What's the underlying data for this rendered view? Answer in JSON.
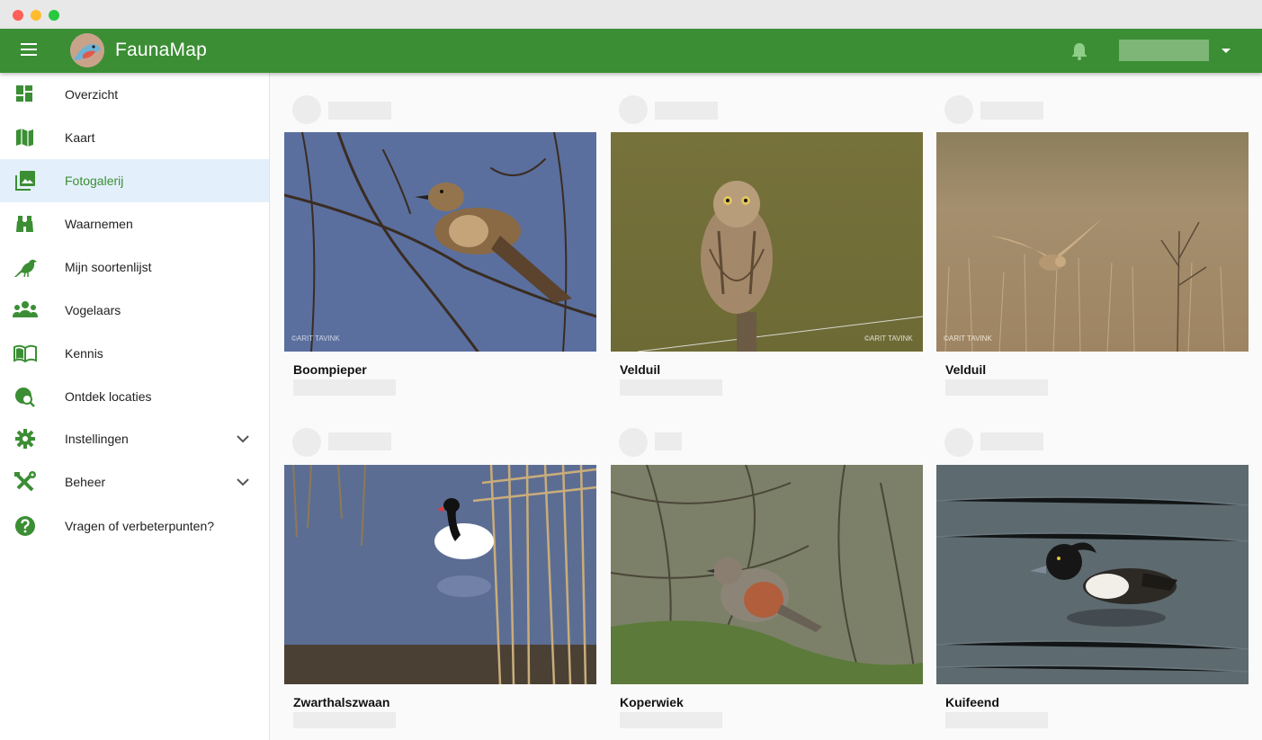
{
  "app": {
    "title": "FaunaMap",
    "brand_color": "#3b8e34",
    "active_color": "#e3f0fb"
  },
  "header": {
    "menu_icon": "hamburger-menu-icon",
    "notification_icon": "bell-icon",
    "user_menu_icon": "caret-down-icon"
  },
  "sidebar": {
    "items": [
      {
        "label": "Overzicht",
        "icon": "dashboard-icon"
      },
      {
        "label": "Kaart",
        "icon": "map-icon"
      },
      {
        "label": "Fotogalerij",
        "icon": "photo-library-icon",
        "active": true
      },
      {
        "label": "Waarnemen",
        "icon": "binoculars-icon"
      },
      {
        "label": "Mijn soortenlijst",
        "icon": "bird-icon"
      },
      {
        "label": "Vogelaars",
        "icon": "people-icon"
      },
      {
        "label": "Kennis",
        "icon": "book-icon"
      },
      {
        "label": "Ontdek locaties",
        "icon": "explore-location-icon"
      },
      {
        "label": "Instellingen",
        "icon": "gear-icon",
        "expandable": true
      },
      {
        "label": "Beheer",
        "icon": "tools-icon",
        "expandable": true
      },
      {
        "label": "Vragen of verbeterpunten?",
        "icon": "help-icon"
      }
    ]
  },
  "gallery": {
    "photos": [
      {
        "species": "Boompieper",
        "watermark": "©ARIT TAVINK"
      },
      {
        "species": "Velduil",
        "watermark": "©ARIT TAVINK"
      },
      {
        "species": "Velduil",
        "watermark": "©ARIT TAVINK"
      },
      {
        "species": "Zwarthalszwaan"
      },
      {
        "species": "Koperwiek"
      },
      {
        "species": "Kuifeend"
      }
    ]
  }
}
